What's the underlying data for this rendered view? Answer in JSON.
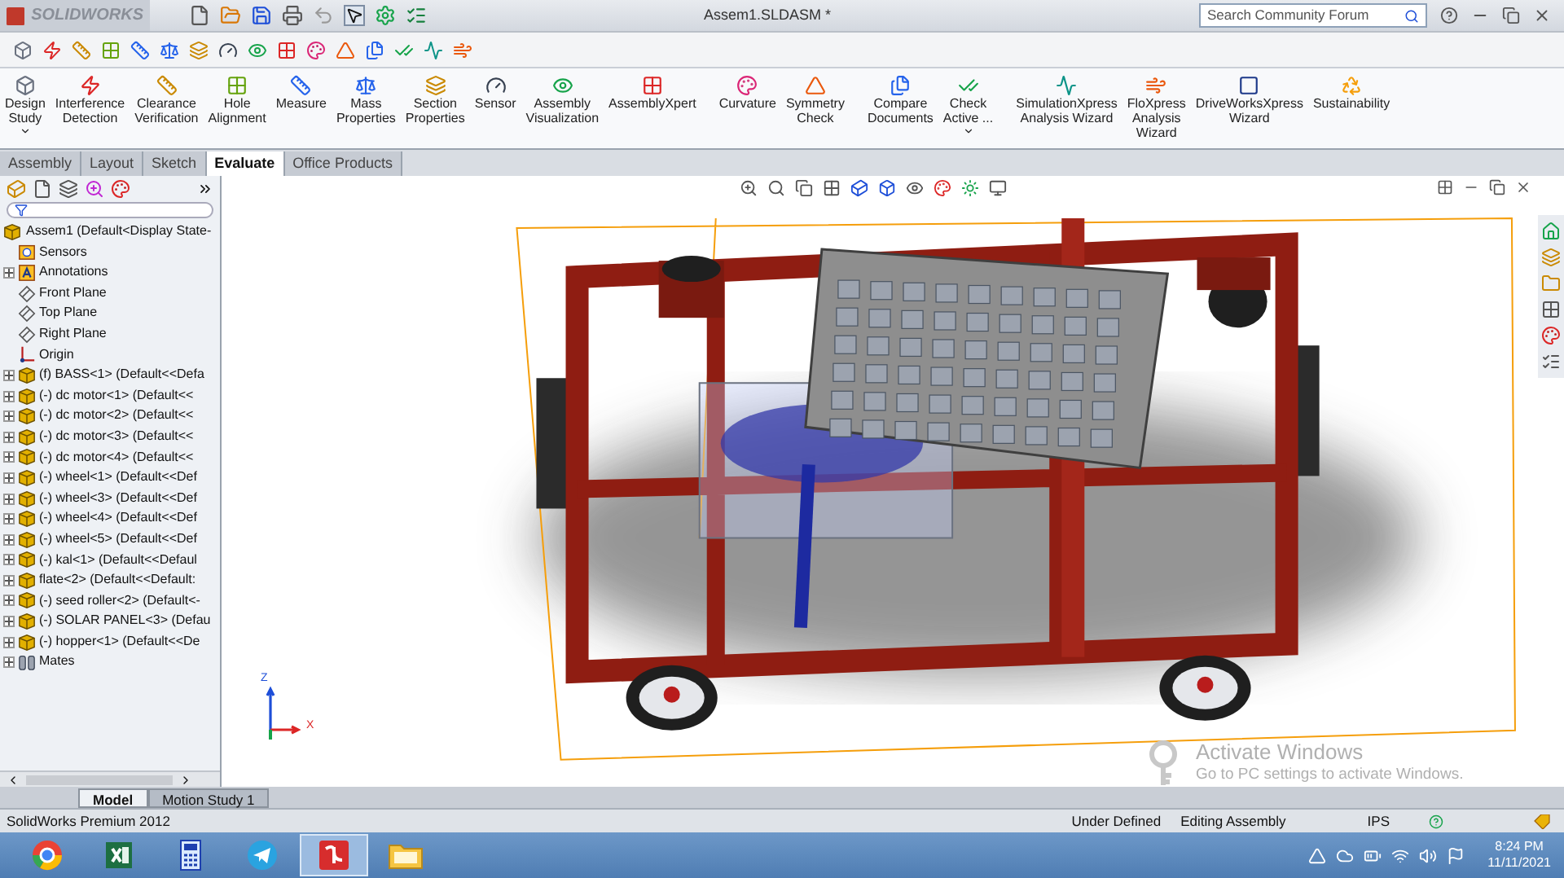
{
  "title_bar": {
    "app_name": "SOLIDWORKS",
    "document": "Assem1.SLDASM *",
    "search": {
      "placeholder": "Search Community Forum"
    }
  },
  "ribbon": {
    "buttons": [
      {
        "label": "Design\nStudy",
        "dropdown": true
      },
      {
        "label": "Interference\nDetection",
        "dropdown": false
      },
      {
        "label": "Clearance\nVerification",
        "dropdown": false
      },
      {
        "label": "Hole\nAlignment",
        "dropdown": false
      },
      {
        "label": "Measure",
        "dropdown": false
      },
      {
        "label": "Mass\nProperties",
        "dropdown": false
      },
      {
        "label": "Section\nProperties",
        "dropdown": false
      },
      {
        "label": "Sensor",
        "dropdown": false
      },
      {
        "label": "Assembly\nVisualization",
        "dropdown": false
      },
      {
        "label": "AssemblyXpert",
        "dropdown": false
      },
      {
        "label": "Curvature",
        "dropdown": false
      },
      {
        "label": "Symmetry\nCheck",
        "dropdown": false
      },
      {
        "label": "Compare\nDocuments",
        "dropdown": false
      },
      {
        "label": "Check\nActive ...",
        "dropdown": true
      },
      {
        "label": "SimulationXpress\nAnalysis Wizard",
        "dropdown": false
      },
      {
        "label": "FloXpress\nAnalysis\nWizard",
        "dropdown": false
      },
      {
        "label": "DriveWorksXpress\nWizard",
        "dropdown": false
      },
      {
        "label": "Sustainability",
        "dropdown": false
      }
    ]
  },
  "tabs": [
    {
      "label": "Assembly",
      "selected": false
    },
    {
      "label": "Layout",
      "selected": false
    },
    {
      "label": "Sketch",
      "selected": false
    },
    {
      "label": "Evaluate",
      "selected": true
    },
    {
      "label": "Office Products",
      "selected": false
    }
  ],
  "tree": {
    "root": {
      "label": "Assem1  (Default<Display State-",
      "kind": "assembly",
      "children": [
        {
          "label": "Sensors",
          "kind": "sensor",
          "collapsed": false
        },
        {
          "label": "Annotations",
          "kind": "annotation",
          "collapsed": true
        },
        {
          "label": "Front Plane",
          "kind": "plane",
          "collapsed": false
        },
        {
          "label": "Top Plane",
          "kind": "plane",
          "collapsed": false
        },
        {
          "label": "Right Plane",
          "kind": "plane",
          "collapsed": false
        },
        {
          "label": "Origin",
          "kind": "origin",
          "collapsed": false
        },
        {
          "label": "(f) BASS<1> (Default<<Defa",
          "kind": "part",
          "collapsed": true
        },
        {
          "label": "(-) dc motor<1> (Default<<",
          "kind": "part",
          "collapsed": true
        },
        {
          "label": "(-) dc motor<2> (Default<<",
          "kind": "part",
          "collapsed": true
        },
        {
          "label": "(-) dc motor<3> (Default<<",
          "kind": "part",
          "collapsed": true
        },
        {
          "label": "(-) dc motor<4> (Default<<",
          "kind": "part",
          "collapsed": true
        },
        {
          "label": "(-) wheel<1> (Default<<Def",
          "kind": "part",
          "collapsed": true
        },
        {
          "label": "(-) wheel<3> (Default<<Def",
          "kind": "part",
          "collapsed": true
        },
        {
          "label": "(-) wheel<4> (Default<<Def",
          "kind": "part",
          "collapsed": true
        },
        {
          "label": "(-) wheel<5> (Default<<Def",
          "kind": "part",
          "collapsed": true
        },
        {
          "label": "(-) kal<1> (Default<<Defaul",
          "kind": "part",
          "collapsed": true
        },
        {
          "label": "flate<2> (Default<<Default:",
          "kind": "part",
          "collapsed": true
        },
        {
          "label": "(-) seed roller<2> (Default<-",
          "kind": "part",
          "collapsed": true
        },
        {
          "label": "(-) SOLAR PANEL<3> (Defau",
          "kind": "part",
          "collapsed": true
        },
        {
          "label": "(-) hopper<1> (Default<<De",
          "kind": "part",
          "collapsed": true
        },
        {
          "label": "Mates",
          "kind": "mates",
          "collapsed": true
        }
      ]
    }
  },
  "triad": {
    "z": "Z",
    "x": "X"
  },
  "watermark": {
    "title": "Activate Windows",
    "text": "Go to PC settings to activate Windows."
  },
  "bottom_tabs": [
    {
      "label": "Model",
      "selected": true
    },
    {
      "label": "Motion Study 1",
      "selected": false
    }
  ],
  "status_bar": {
    "product": "SolidWorks Premium 2012",
    "state": "Under Defined",
    "mode": "Editing Assembly",
    "units": "IPS"
  },
  "taskbar": {
    "apps": [
      {
        "kind": "chrome",
        "selected": false
      },
      {
        "kind": "excel",
        "selected": false
      },
      {
        "kind": "calculator",
        "selected": false
      },
      {
        "kind": "telegram",
        "selected": false
      },
      {
        "kind": "solidworks",
        "selected": true
      },
      {
        "kind": "explorer",
        "selected": false
      }
    ],
    "time": "8:24 PM",
    "date": "11/11/2021"
  }
}
